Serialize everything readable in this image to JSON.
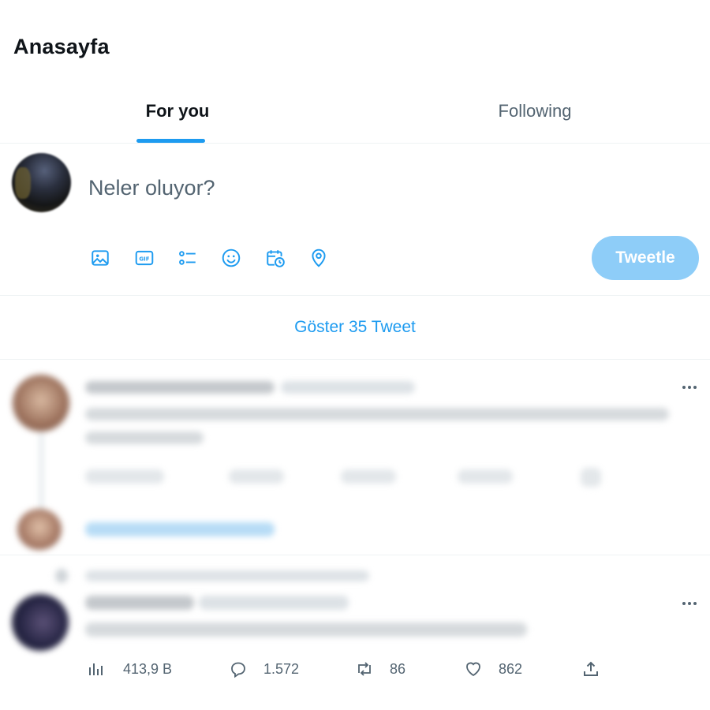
{
  "header": {
    "title": "Anasayfa"
  },
  "tabs": [
    {
      "label": "For you",
      "active": true
    },
    {
      "label": "Following",
      "active": false
    }
  ],
  "composer": {
    "placeholder": "Neler oluyor?",
    "tools": [
      "image-icon",
      "gif-icon",
      "poll-icon",
      "emoji-icon",
      "schedule-icon",
      "location-icon"
    ],
    "submit_label": "Tweetle"
  },
  "timeline": {
    "show_more_label": "Göster 35 Tweet"
  },
  "tweet2": {
    "stats": {
      "views": "413,9 B",
      "replies": "1.572",
      "retweets": "86",
      "likes": "862"
    }
  },
  "colors": {
    "accent": "#1d9bf0",
    "button_disabled": "#8ecdf8",
    "secondary_text": "#536471",
    "divider": "#eff3f4"
  }
}
